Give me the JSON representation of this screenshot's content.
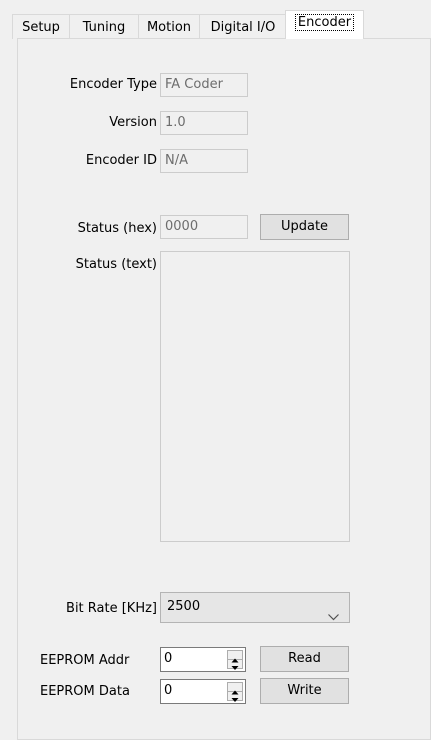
{
  "tabs": [
    {
      "label": "Setup"
    },
    {
      "label": "Tuning"
    },
    {
      "label": "Motion"
    },
    {
      "label": "Digital I/O"
    },
    {
      "label": "Encoder"
    }
  ],
  "encoder": {
    "type_label": "Encoder Type",
    "type_value": "FA Coder",
    "version_label": "Version",
    "version_value": "1.0",
    "id_label": "Encoder ID",
    "id_value": "N/A",
    "status_hex_label": "Status (hex)",
    "status_hex_value": "0000",
    "update_button": "Update",
    "status_text_label": "Status (text)",
    "status_text_value": "",
    "bitrate_label": "Bit Rate [KHz]",
    "bitrate_value": "2500",
    "eeprom_addr_label": "EEPROM Addr",
    "eeprom_addr_value": "0",
    "eeprom_data_label": "EEPROM Data",
    "eeprom_data_value": "0",
    "read_button": "Read",
    "write_button": "Write"
  },
  "icons": {
    "dropdown": "chevron-down-icon",
    "spin_up": "spin-up-icon",
    "spin_down": "spin-down-icon"
  }
}
